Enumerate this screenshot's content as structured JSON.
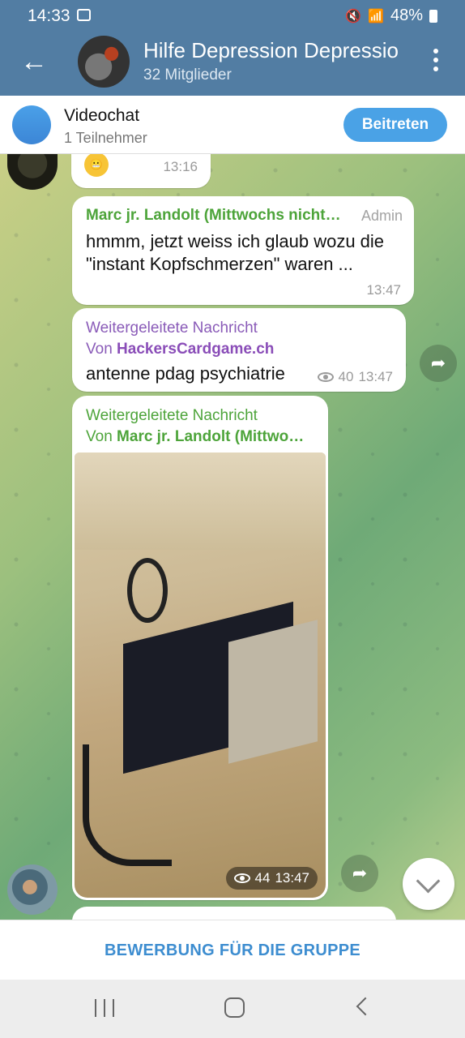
{
  "status_bar": {
    "time": "14:33",
    "battery": "48%"
  },
  "header": {
    "title": "Hilfe Depression Depressio",
    "subtitle": "32 Mitglieder"
  },
  "videochat": {
    "title": "Videochat",
    "subtitle": "1 Teilnehmer",
    "join_label": "Beitreten"
  },
  "messages": [
    {
      "emoji": "😬",
      "time": "13:16"
    },
    {
      "sender": "Marc jr. Landolt (Mittwochs nicht…",
      "role": "Admin",
      "text": "hmmm, jetzt weiss ich glaub wozu die \"instant Kopfschmerzen\" waren ...",
      "time": "13:47"
    },
    {
      "forward_label": "Weitergeleitete Nachricht",
      "forward_prefix": "Von",
      "forward_from": "HackersCardgame.ch",
      "text": "antenne pdag psychiatrie",
      "views": "40",
      "time": "13:47"
    },
    {
      "forward_label": "Weitergeleitete Nachricht",
      "forward_prefix": "Von",
      "forward_from": "Marc jr. Landolt (Mittwo…",
      "views": "44",
      "time": "13:47"
    }
  ],
  "apply_button": "BEWERBUNG FÜR DIE GRUPPE"
}
